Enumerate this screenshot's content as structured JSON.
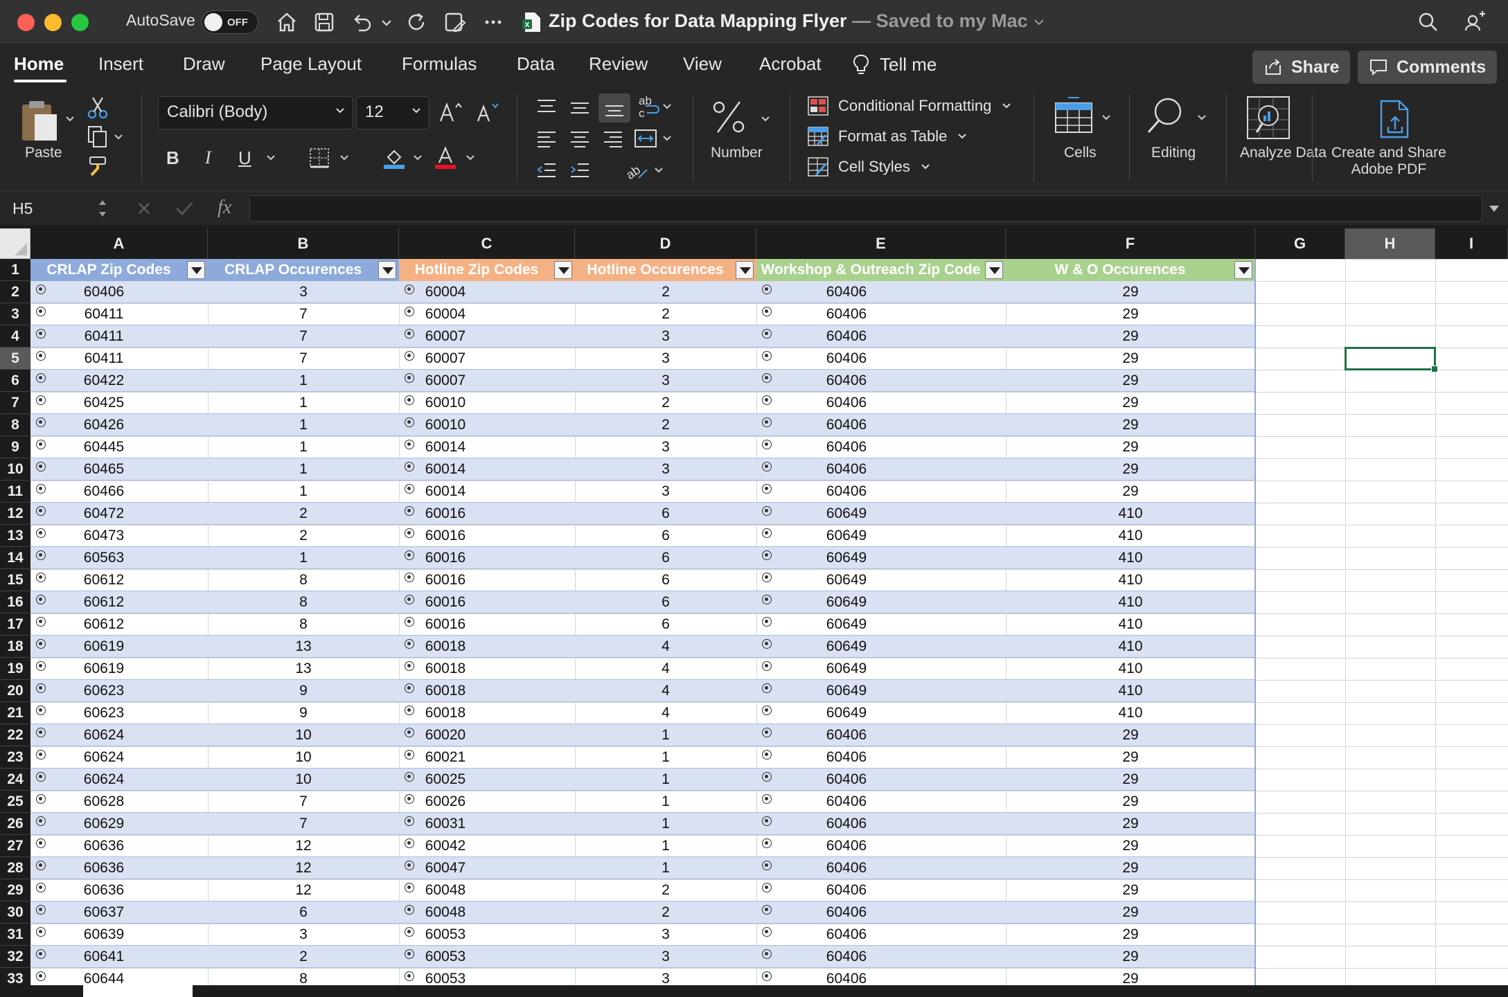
{
  "window": {
    "autosave_label": "AutoSave",
    "autosave_state": "OFF",
    "doc_title": "Zip Codes for Data Mapping Flyer",
    "doc_status": "— Saved to my Mac"
  },
  "menu": {
    "items": [
      "Home",
      "Insert",
      "Draw",
      "Page Layout",
      "Formulas",
      "Data",
      "Review",
      "View",
      "Acrobat"
    ],
    "tell_me": "Tell me",
    "share": "Share",
    "comments": "Comments"
  },
  "ribbon": {
    "paste": "Paste",
    "font_name": "Calibri (Body)",
    "font_size": "12",
    "bold": "B",
    "italic": "I",
    "underline": "U",
    "number": "Number",
    "conditional_formatting": "Conditional Formatting",
    "format_as_table": "Format as Table",
    "cell_styles": "Cell Styles",
    "cells": "Cells",
    "editing": "Editing",
    "analyze_data": "Analyze Data",
    "create_share_pdf_1": "Create and Share",
    "create_share_pdf_2": "Adobe PDF"
  },
  "formula_bar": {
    "name_box": "H5",
    "fx": "fx",
    "content": ""
  },
  "sheet": {
    "columns": [
      "A",
      "B",
      "C",
      "D",
      "E",
      "F",
      "G",
      "H",
      "I"
    ],
    "selected_column": "H",
    "selected_row": 5,
    "headers": [
      "CRLAP Zip Codes",
      "CRLAP Occurences",
      "Hotline Zip Codes",
      "Hotline Occurences",
      "Workshop & Outreach Zip Code",
      "W & O Occurences"
    ],
    "header_colors": [
      "#8eaadb",
      "#8eaadb",
      "#f4b183",
      "#f4b183",
      "#a9d18e",
      "#a9d18e"
    ],
    "band_color": "#d9e1f2",
    "rows": [
      [
        "60406",
        "3",
        "60004",
        "2",
        "60406",
        "29"
      ],
      [
        "60411",
        "7",
        "60004",
        "2",
        "60406",
        "29"
      ],
      [
        "60411",
        "7",
        "60007",
        "3",
        "60406",
        "29"
      ],
      [
        "60411",
        "7",
        "60007",
        "3",
        "60406",
        "29"
      ],
      [
        "60422",
        "1",
        "60007",
        "3",
        "60406",
        "29"
      ],
      [
        "60425",
        "1",
        "60010",
        "2",
        "60406",
        "29"
      ],
      [
        "60426",
        "1",
        "60010",
        "2",
        "60406",
        "29"
      ],
      [
        "60445",
        "1",
        "60014",
        "3",
        "60406",
        "29"
      ],
      [
        "60465",
        "1",
        "60014",
        "3",
        "60406",
        "29"
      ],
      [
        "60466",
        "1",
        "60014",
        "3",
        "60406",
        "29"
      ],
      [
        "60472",
        "2",
        "60016",
        "6",
        "60649",
        "410"
      ],
      [
        "60473",
        "2",
        "60016",
        "6",
        "60649",
        "410"
      ],
      [
        "60563",
        "1",
        "60016",
        "6",
        "60649",
        "410"
      ],
      [
        "60612",
        "8",
        "60016",
        "6",
        "60649",
        "410"
      ],
      [
        "60612",
        "8",
        "60016",
        "6",
        "60649",
        "410"
      ],
      [
        "60612",
        "8",
        "60016",
        "6",
        "60649",
        "410"
      ],
      [
        "60619",
        "13",
        "60018",
        "4",
        "60649",
        "410"
      ],
      [
        "60619",
        "13",
        "60018",
        "4",
        "60649",
        "410"
      ],
      [
        "60623",
        "9",
        "60018",
        "4",
        "60649",
        "410"
      ],
      [
        "60623",
        "9",
        "60018",
        "4",
        "60649",
        "410"
      ],
      [
        "60624",
        "10",
        "60020",
        "1",
        "60406",
        "29"
      ],
      [
        "60624",
        "10",
        "60021",
        "1",
        "60406",
        "29"
      ],
      [
        "60624",
        "10",
        "60025",
        "1",
        "60406",
        "29"
      ],
      [
        "60628",
        "7",
        "60026",
        "1",
        "60406",
        "29"
      ],
      [
        "60629",
        "7",
        "60031",
        "1",
        "60406",
        "29"
      ],
      [
        "60636",
        "12",
        "60042",
        "1",
        "60406",
        "29"
      ],
      [
        "60636",
        "12",
        "60047",
        "1",
        "60406",
        "29"
      ],
      [
        "60636",
        "12",
        "60048",
        "2",
        "60406",
        "29"
      ],
      [
        "60637",
        "6",
        "60048",
        "2",
        "60406",
        "29"
      ],
      [
        "60639",
        "3",
        "60053",
        "3",
        "60406",
        "29"
      ],
      [
        "60641",
        "2",
        "60053",
        "3",
        "60406",
        "29"
      ],
      [
        "60644",
        "8",
        "60053",
        "3",
        "60406",
        "29"
      ]
    ]
  }
}
